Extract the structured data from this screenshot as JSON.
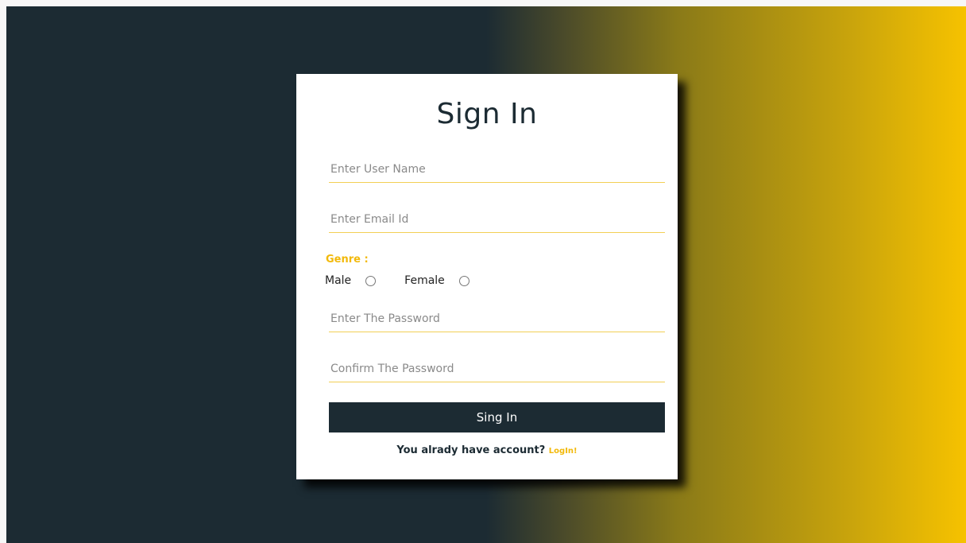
{
  "form": {
    "title": "Sign In",
    "username_placeholder": "Enter User Name",
    "email_placeholder": "Enter Email Id",
    "genre_label": "Genre :",
    "gender_options": [
      "Male",
      "Female"
    ],
    "password_placeholder": "Enter The Password",
    "confirm_placeholder": "Confirm The Password",
    "submit_label": "Sing In",
    "footer_text": "You alrady have account?",
    "login_link": "LogIn!"
  },
  "colors": {
    "dark": "#1c2b33",
    "accent": "#f2b90a",
    "gradient_end": "#f6c200"
  }
}
